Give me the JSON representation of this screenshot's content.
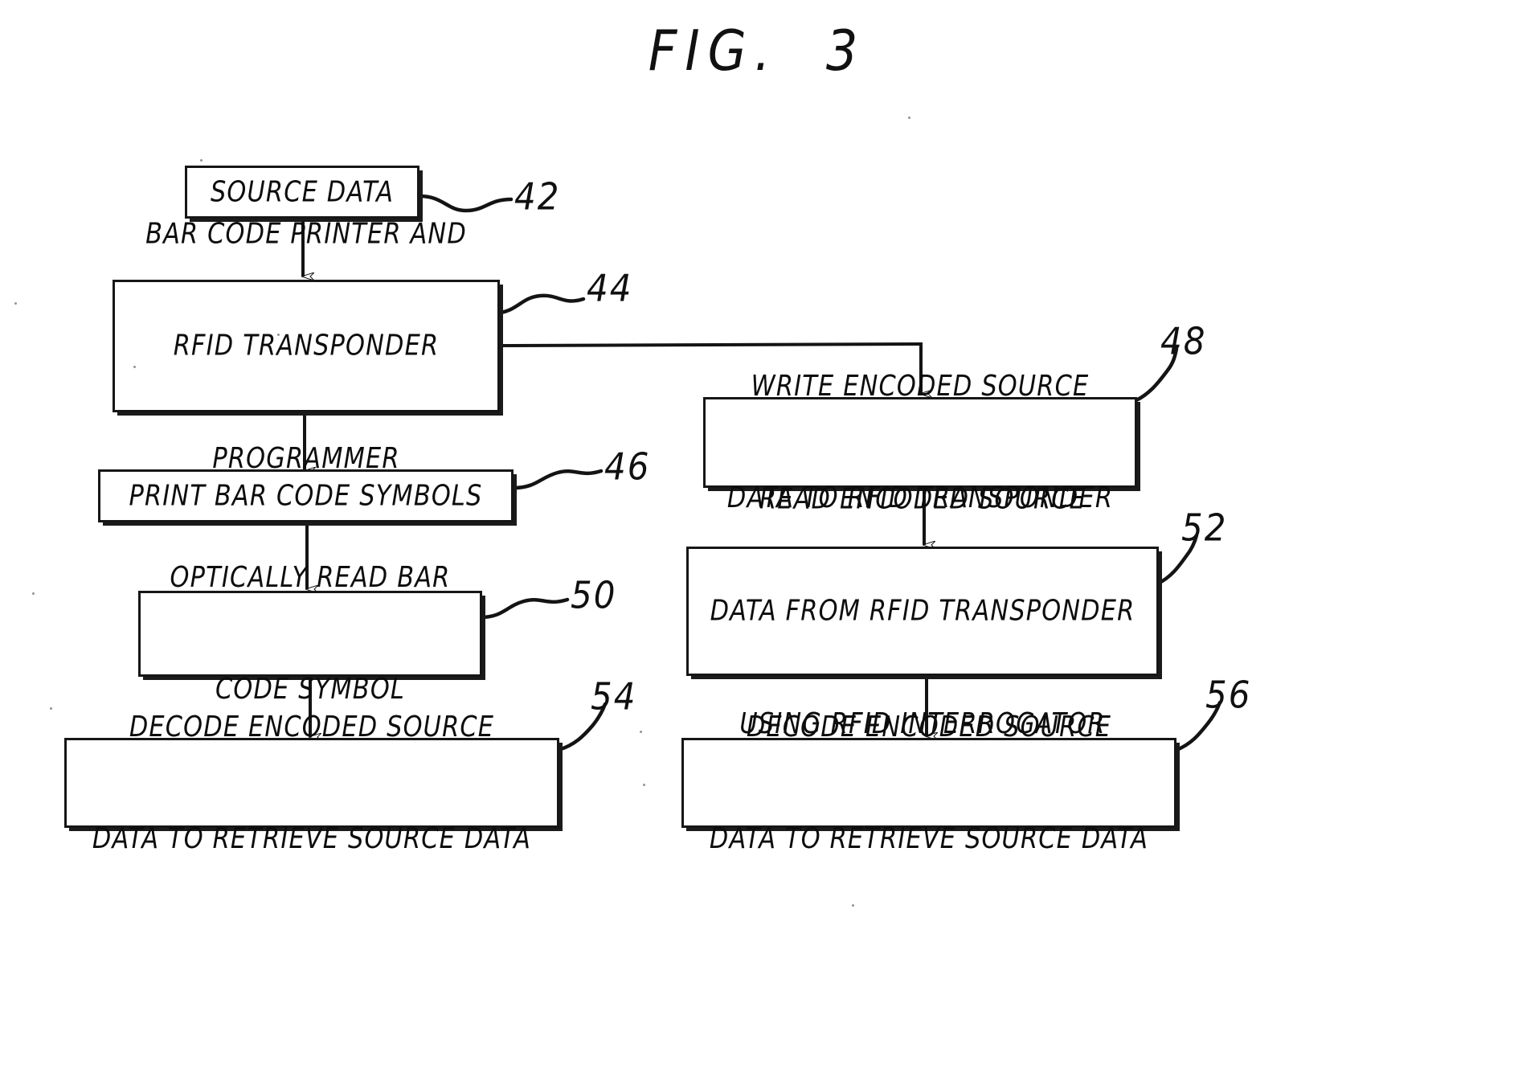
{
  "figure": {
    "title": "FIG.  3",
    "type": "patent-flowchart",
    "ink_color": "#141414",
    "background_color": "#ffffff"
  },
  "nodes": [
    {
      "id": "source-data",
      "ref": "42",
      "lines": [
        "SOURCE DATA"
      ]
    },
    {
      "id": "printer-programmer",
      "ref": "44",
      "lines": [
        "BAR CODE PRINTER AND",
        "RFID TRANSPONDER",
        "PROGRAMMER"
      ]
    },
    {
      "id": "print-bar-code-symbols",
      "ref": "46",
      "lines": [
        "PRINT BAR CODE SYMBOLS"
      ]
    },
    {
      "id": "write-encoded-source-data",
      "ref": "48",
      "lines": [
        "WRITE ENCODED SOURCE",
        "DATA TO RFID TRANSPONDER"
      ]
    },
    {
      "id": "optically-read-bar-code-symbol",
      "ref": "50",
      "lines": [
        "OPTICALLY READ BAR",
        "CODE SYMBOL"
      ]
    },
    {
      "id": "read-encoded-source-data",
      "ref": "52",
      "lines": [
        "READ ENCODED SOURCE",
        "DATA FROM RFID TRANSPONDER",
        "USING RFID INTERROGATOR"
      ]
    },
    {
      "id": "decode-left",
      "ref": "54",
      "lines": [
        "DECODE ENCODED SOURCE",
        "DATA TO RETRIEVE SOURCE DATA"
      ]
    },
    {
      "id": "decode-right",
      "ref": "56",
      "lines": [
        "DECODE ENCODED SOURCE",
        "DATA TO RETRIEVE SOURCE DATA"
      ]
    }
  ],
  "refs": {
    "n42": "42",
    "n44": "44",
    "n46": "46",
    "n48": "48",
    "n50": "50",
    "n52": "52",
    "n54": "54",
    "n56": "56"
  },
  "flow": {
    "edges": [
      {
        "from": "source-data",
        "to": "printer-programmer",
        "kind": "arrow-down"
      },
      {
        "from": "printer-programmer",
        "to": "print-bar-code-symbols",
        "kind": "arrow-down"
      },
      {
        "from": "printer-programmer",
        "to": "write-encoded-source-data",
        "kind": "elbow-right-down"
      },
      {
        "from": "print-bar-code-symbols",
        "to": "optically-read-bar-code-symbol",
        "kind": "arrow-down"
      },
      {
        "from": "optically-read-bar-code-symbol",
        "to": "decode-left",
        "kind": "arrow-down"
      },
      {
        "from": "write-encoded-source-data",
        "to": "read-encoded-source-data",
        "kind": "arrow-down"
      },
      {
        "from": "read-encoded-source-data",
        "to": "decode-right",
        "kind": "arrow-down"
      }
    ]
  }
}
